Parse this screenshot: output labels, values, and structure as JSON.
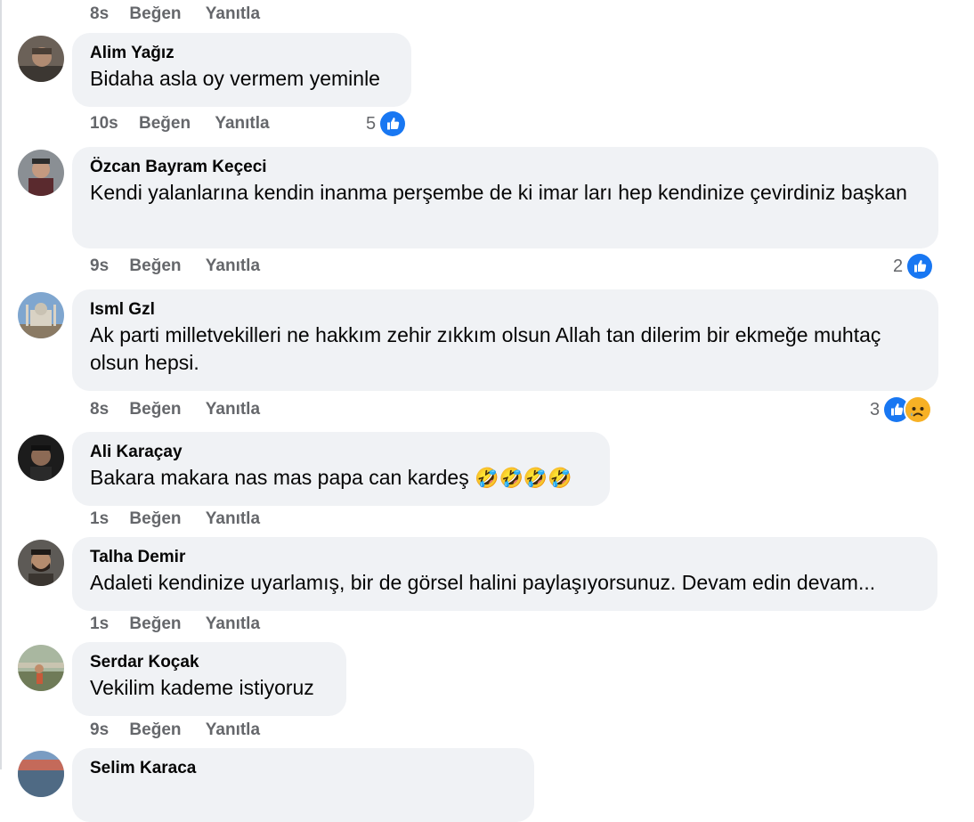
{
  "actions": {
    "like": "Beğen",
    "reply": "Yanıtla"
  },
  "top_meta": {
    "time": "8s"
  },
  "comments": [
    {
      "author": "Alim Yağız",
      "text": "Bidaha asla oy vermem yeminle",
      "time": "10s",
      "reaction_count": "5",
      "reactions": [
        "like-icon"
      ]
    },
    {
      "author": "Özcan Bayram Keçeci",
      "text": "Kendi yalanlarına kendin inanma perşembe de ki imar ları hep kendinize çevirdiniz başkan",
      "time": "9s",
      "reaction_count": "2",
      "reactions": [
        "like-icon"
      ]
    },
    {
      "author": "Isml Gzl",
      "text": "Ak parti milletvekilleri ne hakkım zehir zıkkım olsun Allah tan dilerim bir ekmeğe muhtaç olsun hepsi.",
      "time": "8s",
      "reaction_count": "3",
      "reactions": [
        "like-icon",
        "sad-icon"
      ]
    },
    {
      "author": "Ali Karaçay",
      "text": "Bakara makara nas mas papa can kardeş",
      "emoji": "🤣🤣🤣🤣",
      "time": "1s"
    },
    {
      "author": "Talha Demir",
      "text": "Adaleti kendinize uyarlamış, bir de görsel halini paylaşıyorsunuz. Devam edin devam...",
      "time": "1s"
    },
    {
      "author": "Serdar Koçak",
      "text": "Vekilim kademe istiyoruz",
      "time": "9s"
    },
    {
      "author": "Selim Karaca"
    }
  ],
  "colors": {
    "bubble": "#f0f2f5",
    "meta": "#65676b",
    "like_blue": "#1877f2",
    "sad_yellow": "#f7b125"
  }
}
